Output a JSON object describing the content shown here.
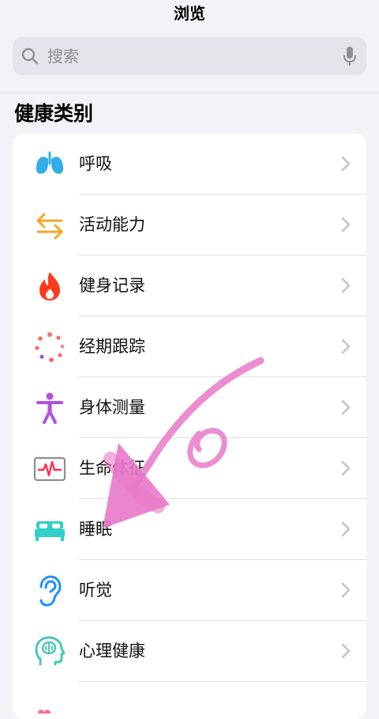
{
  "nav": {
    "title": "浏览"
  },
  "search": {
    "placeholder": "搜索"
  },
  "section": {
    "title": "健康类别"
  },
  "categories": [
    {
      "label": "呼吸",
      "icon": "lungs-icon",
      "color": "#32ade6"
    },
    {
      "label": "活动能力",
      "icon": "arrows-swap-icon",
      "color": "#f5a623"
    },
    {
      "label": "健身记录",
      "icon": "flame-icon",
      "color": "#ff3b1f"
    },
    {
      "label": "经期跟踪",
      "icon": "cycle-dots-icon",
      "color": "#ff6b6b"
    },
    {
      "label": "身体测量",
      "icon": "person-figure-icon",
      "color": "#af52de"
    },
    {
      "label": "生命体征",
      "icon": "heart-rate-icon",
      "color": "#ff2d55"
    },
    {
      "label": "睡眠",
      "icon": "bed-icon",
      "color": "#30d0c6"
    },
    {
      "label": "听觉",
      "icon": "ear-icon",
      "color": "#1e90ff"
    },
    {
      "label": "心理健康",
      "icon": "brain-head-icon",
      "color": "#3cc7b0"
    }
  ],
  "colors": {
    "background": "#f2f2f7",
    "card": "#ffffff",
    "annotation": "#e879c8"
  }
}
